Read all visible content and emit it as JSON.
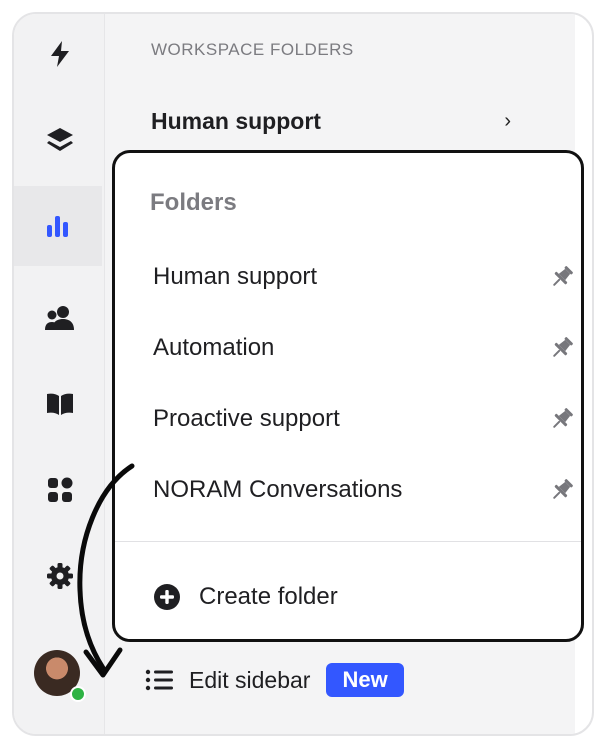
{
  "rail": {
    "items": [
      {
        "icon": "lightning-icon"
      },
      {
        "icon": "layers-icon"
      },
      {
        "icon": "bar-chart-icon",
        "active": true,
        "accent": "#3357ff"
      },
      {
        "icon": "users-icon"
      },
      {
        "icon": "book-icon"
      },
      {
        "icon": "apps-grid-icon"
      },
      {
        "icon": "gear-icon"
      }
    ],
    "avatar_status_color": "#2fb344"
  },
  "panel": {
    "section_title": "WORKSPACE FOLDERS",
    "folder_label": "Human support",
    "folder_chevron": "›",
    "edit_sidebar_label": "Edit sidebar",
    "new_badge": "New",
    "badge_color": "#3357ff"
  },
  "popover": {
    "title": "Folders",
    "items": [
      {
        "label": "Human support",
        "icon": "pin-icon"
      },
      {
        "label": "Automation",
        "icon": "pin-icon"
      },
      {
        "label": "Proactive support",
        "icon": "pin-icon"
      },
      {
        "label": "NORAM Conversations",
        "icon": "pin-icon"
      }
    ],
    "create_label": "Create folder"
  }
}
